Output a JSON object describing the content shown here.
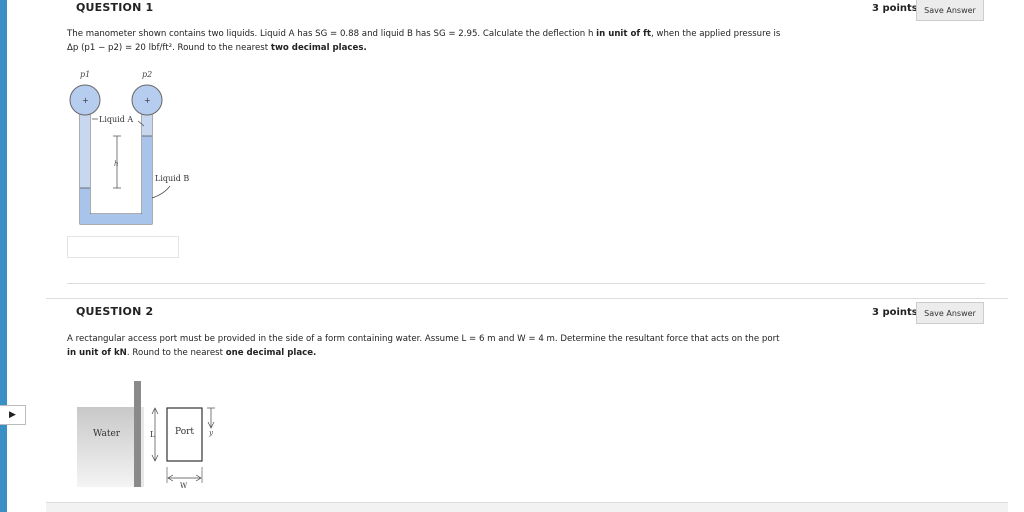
{
  "q1": {
    "title": "QUESTION 1",
    "points": "3 points",
    "save_label": "Save Answer",
    "text_before": "The manometer shown contains two liquids. Liquid A has SG = 0.88 and liquid B has SG = 2.95. Calculate the deflection h ",
    "text_bold1": "in unit of ft",
    "text_mid": ", when the applied pressure is Δp (p1 − p2) = 20 lbf/ft². Round to the nearest ",
    "text_bold2": "two decimal places.",
    "figure": {
      "p1": "p1",
      "p2": "p2",
      "plus1": "+",
      "plus2": "+",
      "liquid_a": "Liquid A",
      "liquid_b": "Liquid B",
      "h": "h"
    }
  },
  "q2": {
    "title": "QUESTION 2",
    "points": "3 points",
    "save_label": "Save Answer",
    "text_before": "A rectangular access port must be provided in the side of a form containing water. Assume L = 6 m and W = 4 m. Determine the resultant force that acts on the port ",
    "text_bold1": "in unit of kN",
    "text_mid": ". Round to the nearest ",
    "text_bold2": "one decimal place.",
    "figure": {
      "water": "Water",
      "port": "Port",
      "l": "L",
      "w": "W",
      "y": "y"
    }
  },
  "colors": {
    "rail": "#3a8fc4",
    "liquid": "#a9c4ea",
    "gauge": "#b7cdef"
  }
}
